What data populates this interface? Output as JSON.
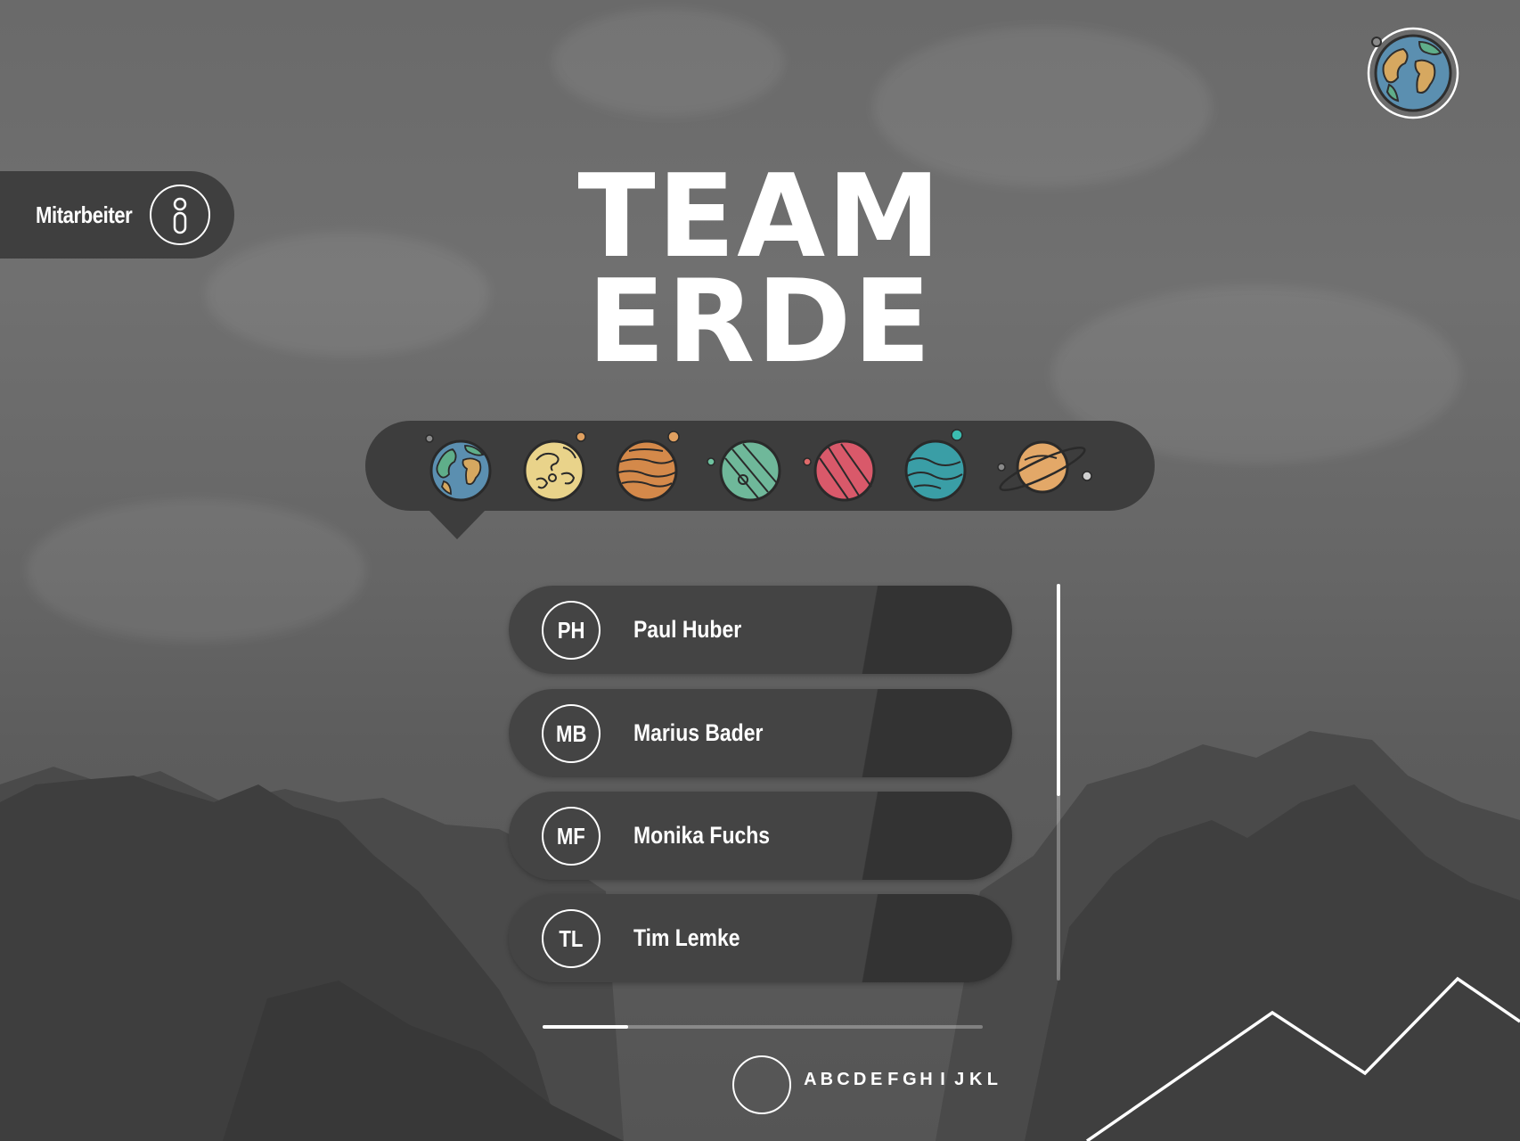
{
  "sidebar": {
    "label": "Mitarbeiter"
  },
  "header": {
    "title_line1": "TEAM",
    "title_line2": "ERDE"
  },
  "planets": [
    {
      "name": "earth",
      "selected": true
    },
    {
      "name": "yellow-planet"
    },
    {
      "name": "orange-planet"
    },
    {
      "name": "green-planet"
    },
    {
      "name": "red-planet"
    },
    {
      "name": "teal-planet"
    },
    {
      "name": "ringed-planet"
    }
  ],
  "employees": [
    {
      "initials": "PH",
      "name": "Paul Huber"
    },
    {
      "initials": "MB",
      "name": "Marius Bader"
    },
    {
      "initials": "MF",
      "name": "Monika Fuchs"
    },
    {
      "initials": "TL",
      "name": "Tim Lemke"
    }
  ],
  "alphabet": [
    "A",
    "B",
    "C",
    "D",
    "E",
    "F",
    "G",
    "H",
    "I",
    "J",
    "K",
    "L"
  ],
  "colors": {
    "panel": "#3d3d3d",
    "earth_ocean": "#5b8fb0",
    "earth_land_green": "#5fae8a",
    "earth_land_tan": "#d6a860"
  }
}
